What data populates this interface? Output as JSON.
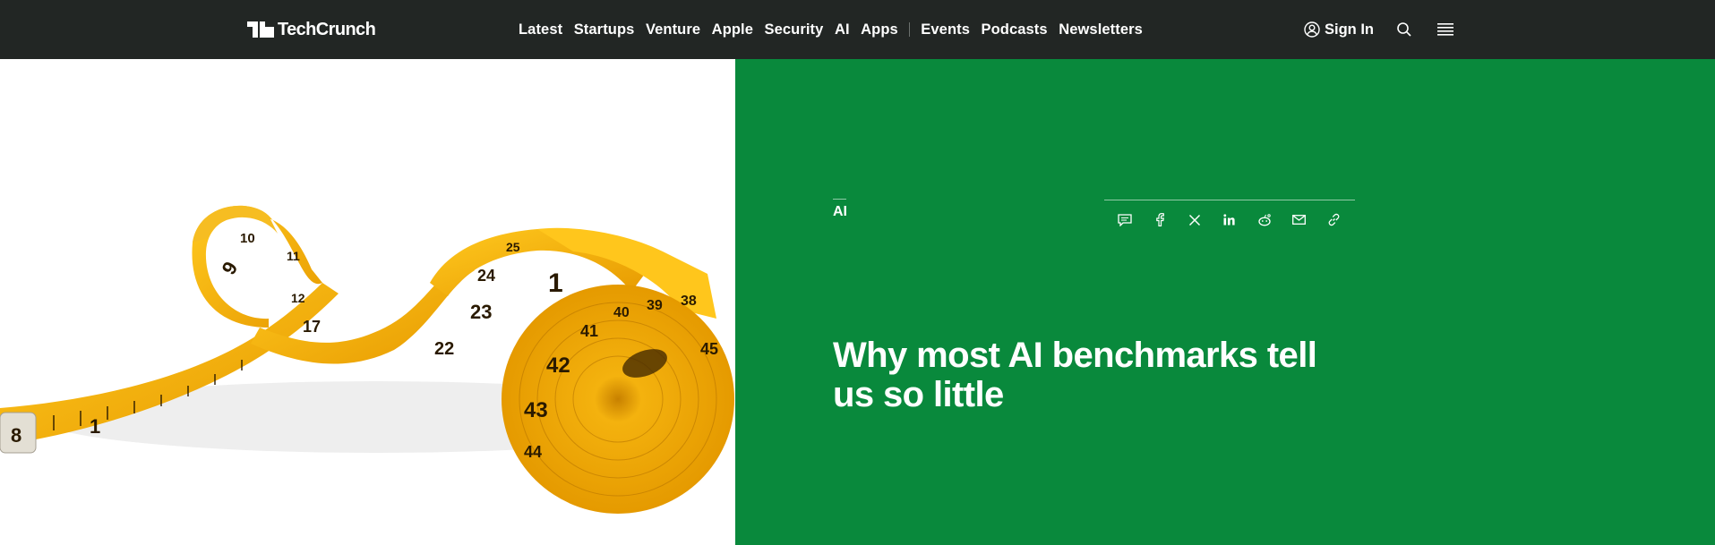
{
  "header": {
    "logo_text": "TechCrunch",
    "nav": [
      {
        "label": "Latest"
      },
      {
        "label": "Startups"
      },
      {
        "label": "Venture"
      },
      {
        "label": "Apple"
      },
      {
        "label": "Security"
      },
      {
        "label": "AI"
      },
      {
        "label": "Apps"
      },
      {
        "label": "Events"
      },
      {
        "label": "Podcasts"
      },
      {
        "label": "Newsletters"
      }
    ],
    "signin_label": "Sign In",
    "icons": [
      "user-icon",
      "search-icon",
      "menu-icon"
    ]
  },
  "hero": {
    "category": "AI",
    "headline": "Why most AI benchmarks tell us so little",
    "share_icons": [
      "comment-icon",
      "facebook-icon",
      "x-icon",
      "linkedin-icon",
      "reddit-icon",
      "email-icon",
      "link-icon"
    ],
    "image_subject": "yellow measuring tape",
    "tape_numbers": [
      "8",
      "1",
      "9",
      "10",
      "11",
      "12",
      "17",
      "22",
      "23",
      "24",
      "25",
      "1",
      "38",
      "39",
      "40",
      "41",
      "42",
      "43",
      "44",
      "45"
    ]
  },
  "colors": {
    "topbar": "#222624",
    "panel": "#09893c",
    "tape": "#f7b70c",
    "text": "#ffffff"
  }
}
